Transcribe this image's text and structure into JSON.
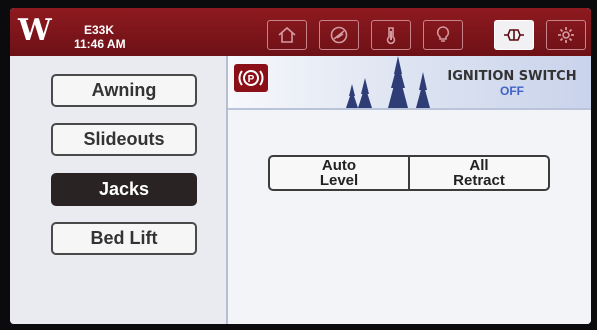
{
  "header": {
    "model": "E33K",
    "time": "11:46 AM",
    "tabs": [
      {
        "icon": "home-icon"
      },
      {
        "icon": "slideout-icon"
      },
      {
        "icon": "thermometer-icon"
      },
      {
        "icon": "lightbulb-icon"
      },
      {
        "icon": "jack-icon",
        "active": true
      },
      {
        "icon": "gear-icon"
      }
    ]
  },
  "sidebar": {
    "items": [
      {
        "label": "Awning"
      },
      {
        "label": "Slideouts"
      },
      {
        "label": "Jacks",
        "active": true
      },
      {
        "label": "Bed Lift"
      }
    ]
  },
  "status": {
    "ignition_label": "IGNITION SWITCH",
    "ignition_value": "OFF",
    "park_symbol": "P"
  },
  "controls": {
    "auto_level": [
      "Auto",
      "Level"
    ],
    "all_retract": [
      "All",
      "Retract"
    ]
  },
  "colors": {
    "header_red": "#7f151b",
    "accent_blue": "#3f63c8",
    "active_button": "#2a2324"
  }
}
